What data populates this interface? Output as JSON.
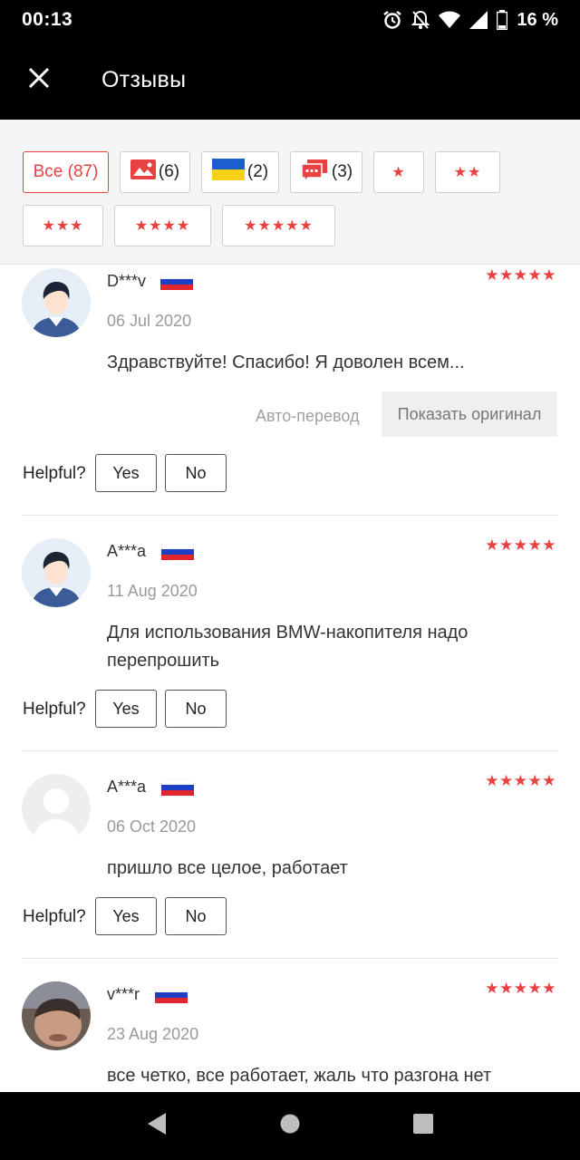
{
  "status_bar": {
    "time": "00:13",
    "battery": "16 %",
    "icons": [
      "alarm-icon",
      "notifications-off-icon",
      "wifi-icon",
      "signal-icon",
      "battery-icon"
    ]
  },
  "header": {
    "title": "Отзывы",
    "close_icon": "close-icon"
  },
  "filters": {
    "all_label": "Все (87)",
    "photo_count": "(6)",
    "country_count": "(2)",
    "comments_count": "(3)",
    "stars": [
      "★",
      "★★",
      "★★★",
      "★★★★",
      "★★★★★"
    ]
  },
  "labels": {
    "helpful": "Helpful?",
    "yes": "Yes",
    "no": "No",
    "auto_translate": "Авто-перевод",
    "show_original": "Показать оригинал"
  },
  "reviews": [
    {
      "user": "D***v",
      "date": "06 Jul 2020",
      "rating_stars": "★★★★★",
      "rating": 5,
      "text": "Здравствуйте! Спасибо! Я доволен всем...",
      "avatar": "avatar-male-icon"
    },
    {
      "user": "A***a",
      "date": "11 Aug 2020",
      "rating_stars": "★★★★★",
      "rating": 5,
      "text": "Для использования BMW-накопителя надо перепрошить",
      "avatar": "avatar-male-icon"
    },
    {
      "user": "A***a",
      "date": "06 Oct 2020",
      "rating_stars": "★★★★★",
      "rating": 5,
      "text": "пришло все целое, работает",
      "avatar": "avatar-placeholder-icon"
    },
    {
      "user": "v***r",
      "date": "23 Aug 2020",
      "rating_stars": "★★★★★",
      "rating": 5,
      "text": "все четко, все работает, жаль что разгона нет",
      "avatar": "avatar-photo"
    }
  ],
  "colors": {
    "accent": "#e94040",
    "header_bg": "#000000",
    "filter_bg": "#f5f5f5"
  }
}
